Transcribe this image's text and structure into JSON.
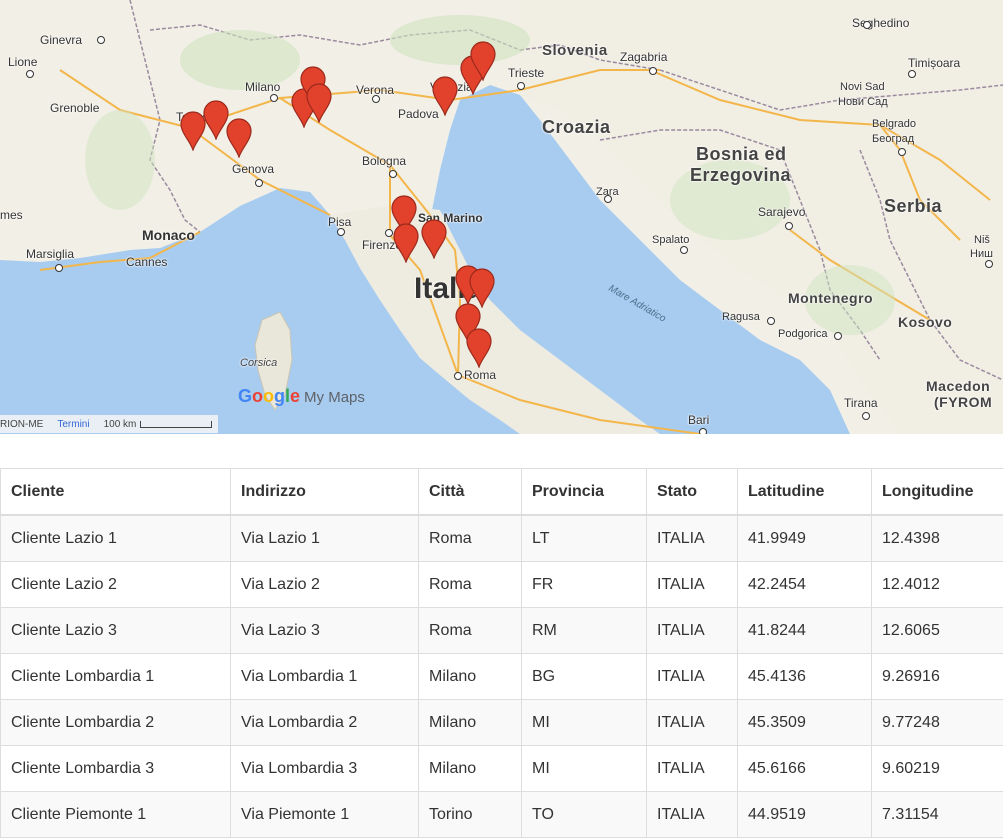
{
  "map": {
    "logo": {
      "g": "G",
      "o1": "o",
      "o2": "o",
      "g2": "g",
      "l": "l",
      "e": "e",
      "suffix": "My Maps"
    },
    "attribution": {
      "source": "RION-ME",
      "terms": "Termini",
      "scale": "100 km"
    },
    "labels": {
      "ginevra": "Ginevra",
      "lione": "Lione",
      "grenoble": "Grenoble",
      "torino": "Torino",
      "milano": "Milano",
      "verona": "Verona",
      "padova": "Padova",
      "venezia": "Venezia",
      "trieste": "Trieste",
      "slovenia": "Slovenia",
      "zagabria": "Zagabria",
      "seghedino": "Seghedino",
      "timisoara": "Timișoara",
      "novi_sad": "Novi Sad",
      "novi_sad_cyr": "Нови Сад",
      "belgrado": "Belgrado",
      "belgrado_cyr": "Београд",
      "croazia": "Croazia",
      "bosnia": "Bosnia ed",
      "erzegovina": "Erzegovina",
      "genova": "Genova",
      "bologna": "Bologna",
      "monaco": "Monaco",
      "marsiglia": "Marsiglia",
      "cannes": "Cannes",
      "pisa": "Pisa",
      "firenze": "Firenze",
      "san_marino": "San Marino",
      "zara": "Zara",
      "sarajevo": "Sarajevo",
      "serbia": "Serbia",
      "nis": "Niš",
      "nis_cyr": "Ниш",
      "spalato": "Spalato",
      "italia": "Italia",
      "mare_adriatico": "Mare Adriatico",
      "montenegro": "Montenegro",
      "ragusa": "Ragusa",
      "podgorica": "Podgorica",
      "kosovo": "Kosovo",
      "corsica": "Corsica",
      "roma": "Roma",
      "tirana": "Tirana",
      "macedon": "Macedon",
      "fyrom": "(FYROM",
      "bari": "Bari",
      "nimes": "mes"
    },
    "markers": [
      {
        "name": "Cliente Lazio 1",
        "lat": 41.9949,
        "lng": 12.4398
      },
      {
        "name": "Cliente Lazio 2",
        "lat": 42.2454,
        "lng": 12.4012
      },
      {
        "name": "Cliente Lazio 3",
        "lat": 41.8244,
        "lng": 12.6065
      },
      {
        "name": "Cliente Lombardia 1",
        "lat": 45.4136,
        "lng": 9.26916
      },
      {
        "name": "Cliente Lombardia 2",
        "lat": 45.3509,
        "lng": 9.77248
      },
      {
        "name": "Cliente Lombardia 3",
        "lat": 45.6166,
        "lng": 9.60219
      },
      {
        "name": "Cliente Piemonte 1",
        "lat": 44.9519,
        "lng": 7.31154
      }
    ],
    "pin_color": "#e2412b"
  },
  "table": {
    "headers": [
      "Cliente",
      "Indirizzo",
      "Città",
      "Provincia",
      "Stato",
      "Latitudine",
      "Longitudine"
    ],
    "rows": [
      [
        "Cliente Lazio 1",
        "Via Lazio 1",
        "Roma",
        "LT",
        "ITALIA",
        "41.9949",
        "12.4398"
      ],
      [
        "Cliente Lazio 2",
        "Via Lazio 2",
        "Roma",
        "FR",
        "ITALIA",
        "42.2454",
        "12.4012"
      ],
      [
        "Cliente Lazio 3",
        "Via Lazio 3",
        "Roma",
        "RM",
        "ITALIA",
        "41.8244",
        "12.6065"
      ],
      [
        "Cliente Lombardia 1",
        "Via Lombardia 1",
        "Milano",
        "BG",
        "ITALIA",
        "45.4136",
        "9.26916"
      ],
      [
        "Cliente Lombardia 2",
        "Via Lombardia 2",
        "Milano",
        "MI",
        "ITALIA",
        "45.3509",
        "9.77248"
      ],
      [
        "Cliente Lombardia 3",
        "Via Lombardia 3",
        "Milano",
        "MI",
        "ITALIA",
        "45.6166",
        "9.60219"
      ],
      [
        "Cliente Piemonte 1",
        "Via Piemonte 1",
        "Torino",
        "TO",
        "ITALIA",
        "44.9519",
        "7.31154"
      ]
    ]
  }
}
